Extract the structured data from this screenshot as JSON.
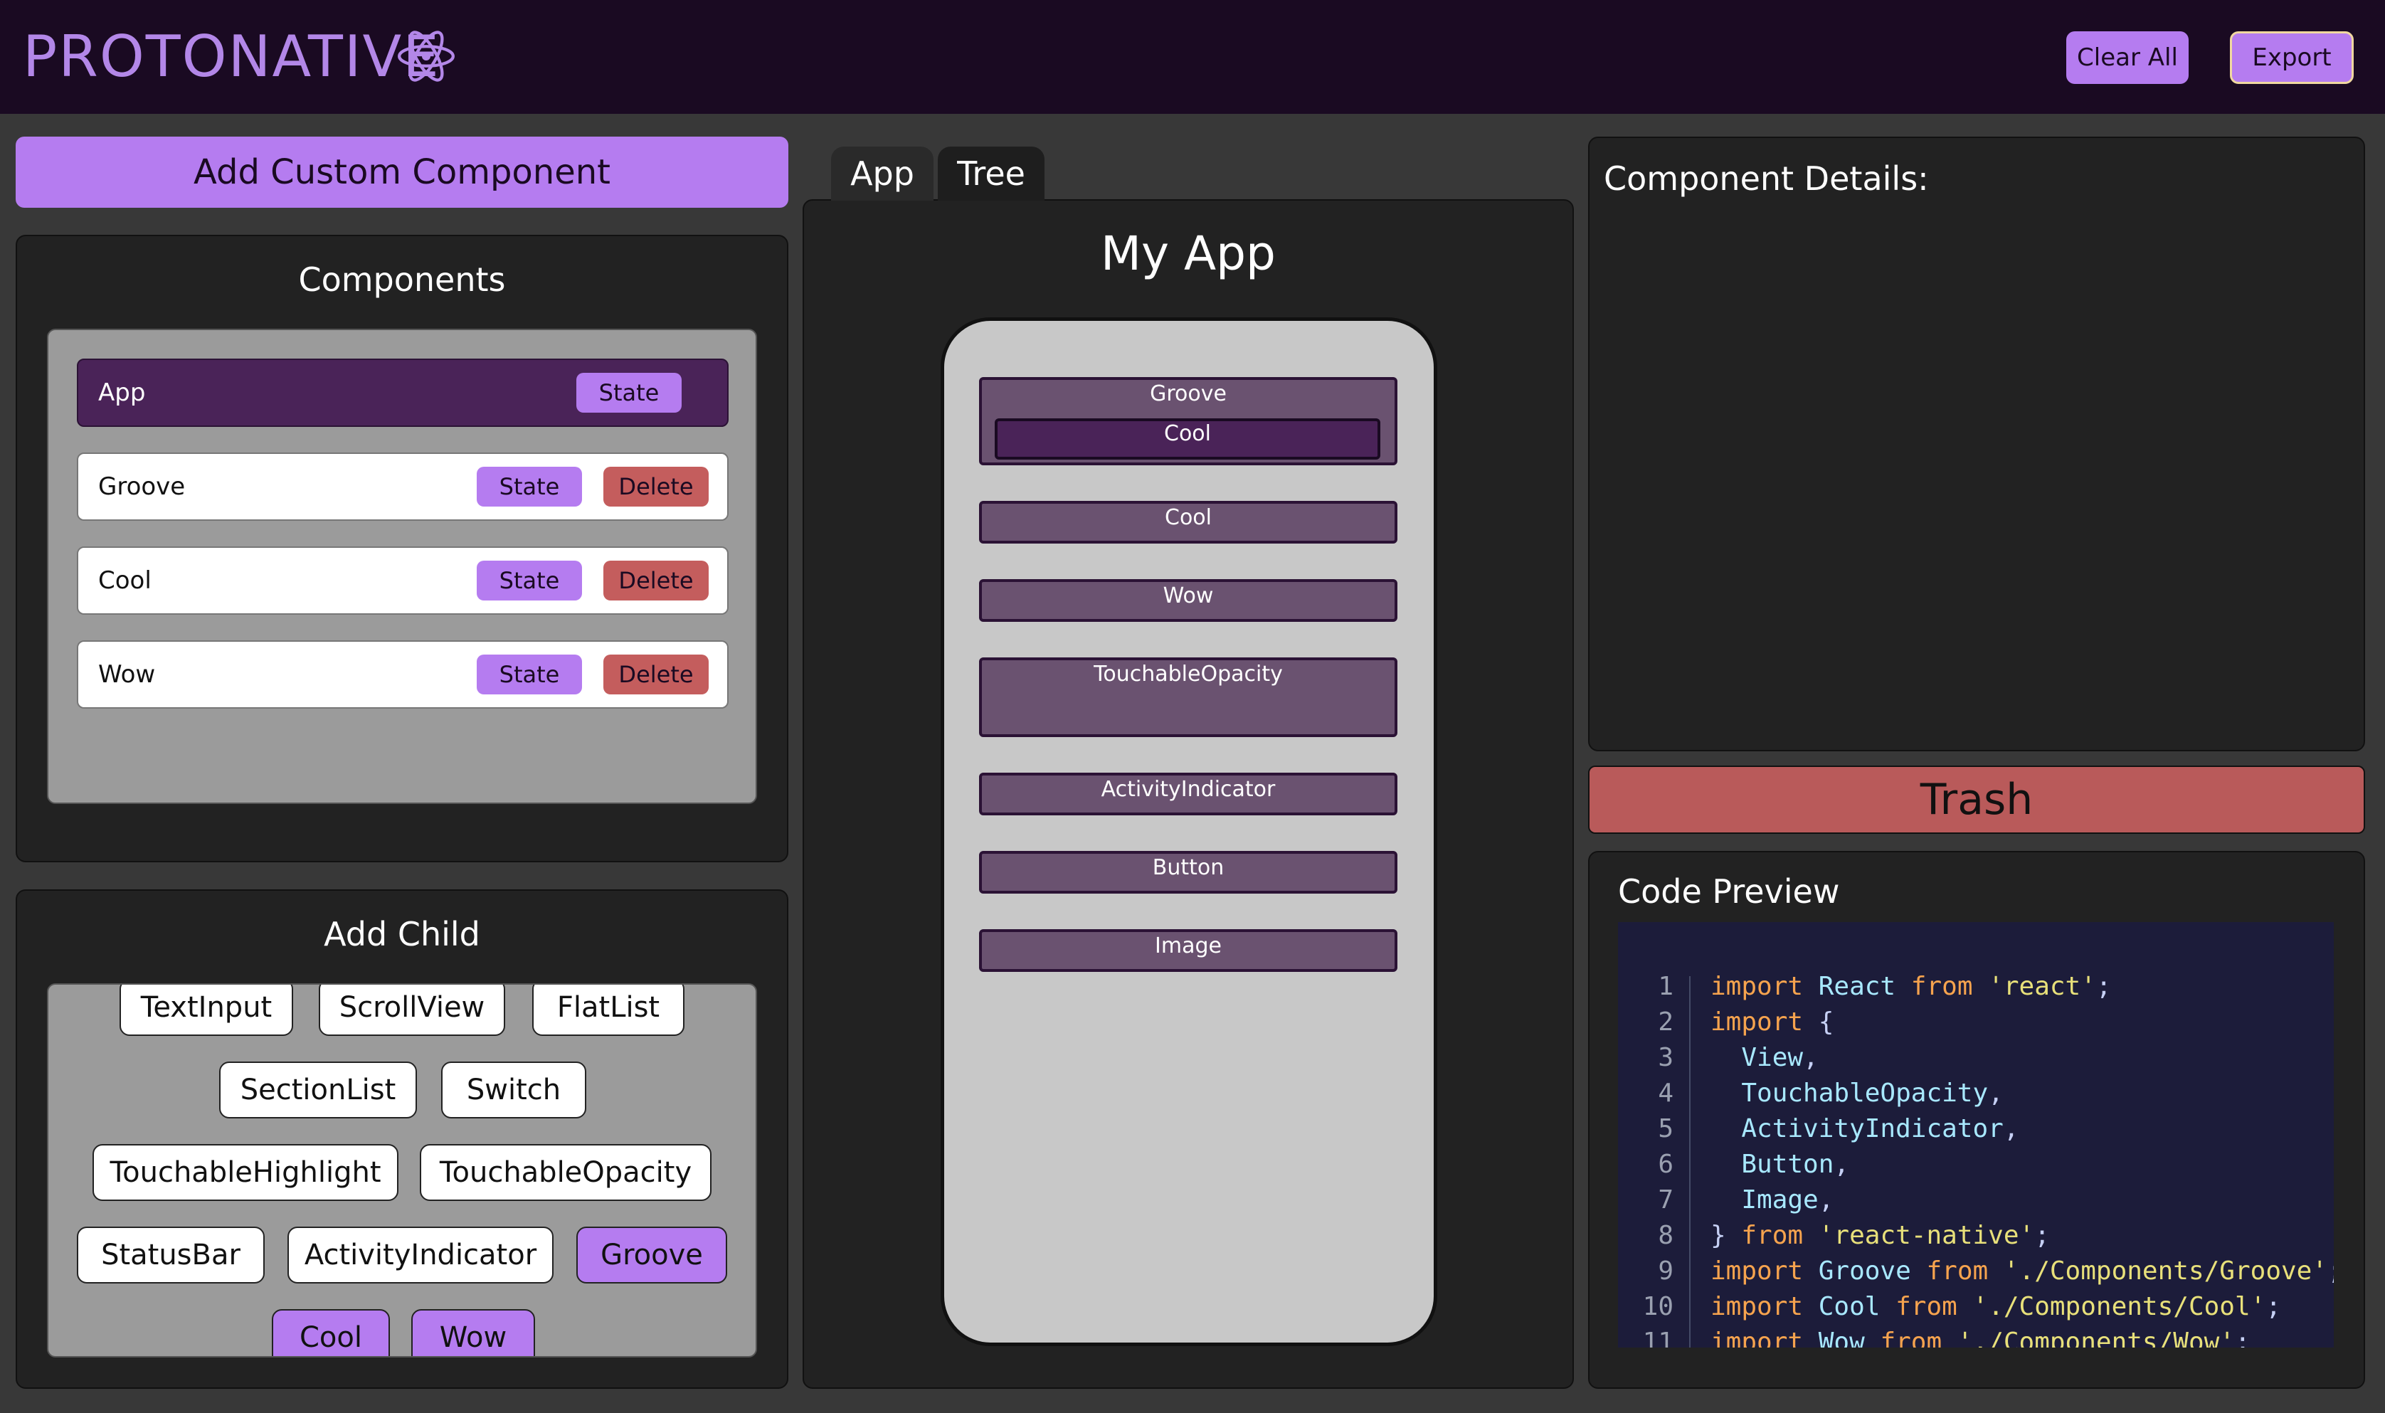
{
  "header": {
    "logo": "PROTONATIVE",
    "clear_all": "Clear All",
    "export": "Export"
  },
  "left": {
    "add_custom": "Add Custom Component",
    "components_title": "Components",
    "components": [
      {
        "name": "App",
        "state": "State"
      },
      {
        "name": "Groove",
        "state": "State",
        "delete": "Delete"
      },
      {
        "name": "Cool",
        "state": "State",
        "delete": "Delete"
      },
      {
        "name": "Wow",
        "state": "State",
        "delete": "Delete"
      }
    ],
    "add_child_title": "Add Child",
    "add_child_chips": [
      "TextInput",
      "ScrollView",
      "FlatList",
      "SectionList",
      "Switch",
      "TouchableHighlight",
      "TouchableOpacity",
      "StatusBar",
      "ActivityIndicator",
      "Groove",
      "Cool",
      "Wow"
    ]
  },
  "center": {
    "tabs": [
      "App",
      "Tree"
    ],
    "title": "My App",
    "boxes": [
      "Groove",
      "Cool",
      "Cool",
      "Wow",
      "TouchableOpacity",
      "ActivityIndicator",
      "Button",
      "Image"
    ]
  },
  "right": {
    "details_title": "Component Details:",
    "trash": "Trash",
    "code_title": "Code Preview"
  },
  "colors": {
    "accent": "#b57cf0",
    "header_bg": "#1a0a22",
    "delete": "#c45d5d",
    "trash": "#b95a5a",
    "active_row": "#4a2358"
  }
}
